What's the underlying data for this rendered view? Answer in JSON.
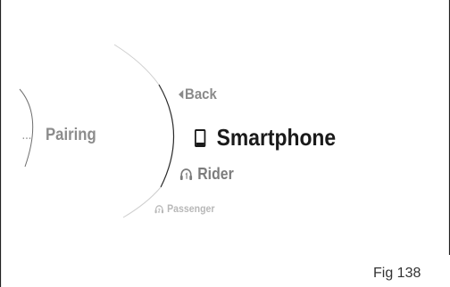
{
  "menu": {
    "ellipsis": "...",
    "parent_label": "Pairing",
    "back_label": "Back",
    "selected_label": "Smartphone",
    "next_label": "Rider",
    "after_next_label": "Passenger",
    "selected_icon": "smartphone-icon",
    "next_icon": "headset-rider-icon",
    "after_next_icon": "headset-passenger-icon",
    "back_icon": "back-arrow-icon"
  },
  "figure": {
    "caption": "Fig 138"
  }
}
